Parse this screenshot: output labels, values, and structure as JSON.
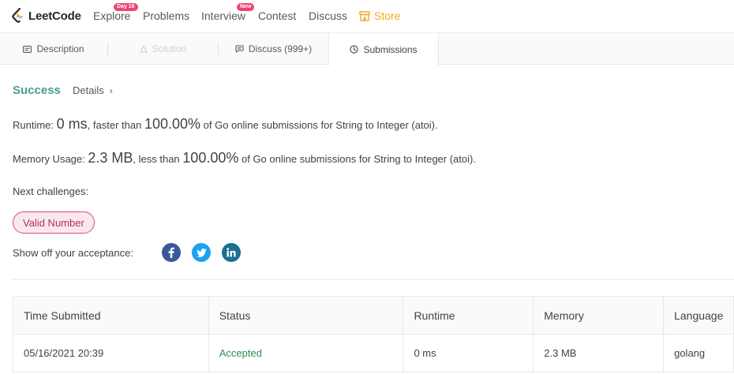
{
  "nav": {
    "logo_text": "LeetCode",
    "items": [
      {
        "label": "Explore",
        "badge": "Day 16"
      },
      {
        "label": "Problems"
      },
      {
        "label": "Interview",
        "badge": "New"
      },
      {
        "label": "Contest"
      },
      {
        "label": "Discuss"
      },
      {
        "label": "Store",
        "icon": "store-icon",
        "color": "#f5a623"
      }
    ]
  },
  "tabs": [
    {
      "label": "Description",
      "icon": "description-icon",
      "state": "normal"
    },
    {
      "label": "Solution",
      "icon": "solution-icon",
      "state": "disabled"
    },
    {
      "label": "Discuss (999+)",
      "icon": "discuss-icon",
      "state": "normal"
    },
    {
      "label": "Submissions",
      "icon": "clock-icon",
      "state": "active"
    }
  ],
  "result": {
    "status": "Success",
    "details_label": "Details",
    "status_color": "#4a9d8f"
  },
  "runtime": {
    "label": "Runtime:",
    "value": "0 ms",
    "mid": ", faster than",
    "percent": "100.00%",
    "suffix": "of Go online submissions for String to Integer (atoi)."
  },
  "memory": {
    "label": "Memory Usage:",
    "value": "2.3 MB",
    "mid": ", less than",
    "percent": "100.00%",
    "suffix": "of Go online submissions for String to Integer (atoi)."
  },
  "next": {
    "label": "Next challenges:",
    "challenges": [
      "Valid Number"
    ]
  },
  "share": {
    "label": "Show off your acceptance:",
    "networks": [
      {
        "name": "facebook-icon",
        "color": "#3b5998"
      },
      {
        "name": "twitter-icon",
        "color": "#1da1f2"
      },
      {
        "name": "linkedin-icon",
        "color": "#1b6f91"
      }
    ]
  },
  "submissions": {
    "columns": [
      "Time Submitted",
      "Status",
      "Runtime",
      "Memory",
      "Language"
    ],
    "rows": [
      {
        "time": "05/16/2021 20:39",
        "status": "Accepted",
        "runtime": "0 ms",
        "memory": "2.3 MB",
        "language": "golang"
      }
    ],
    "accepted_color": "#2e8b57"
  }
}
